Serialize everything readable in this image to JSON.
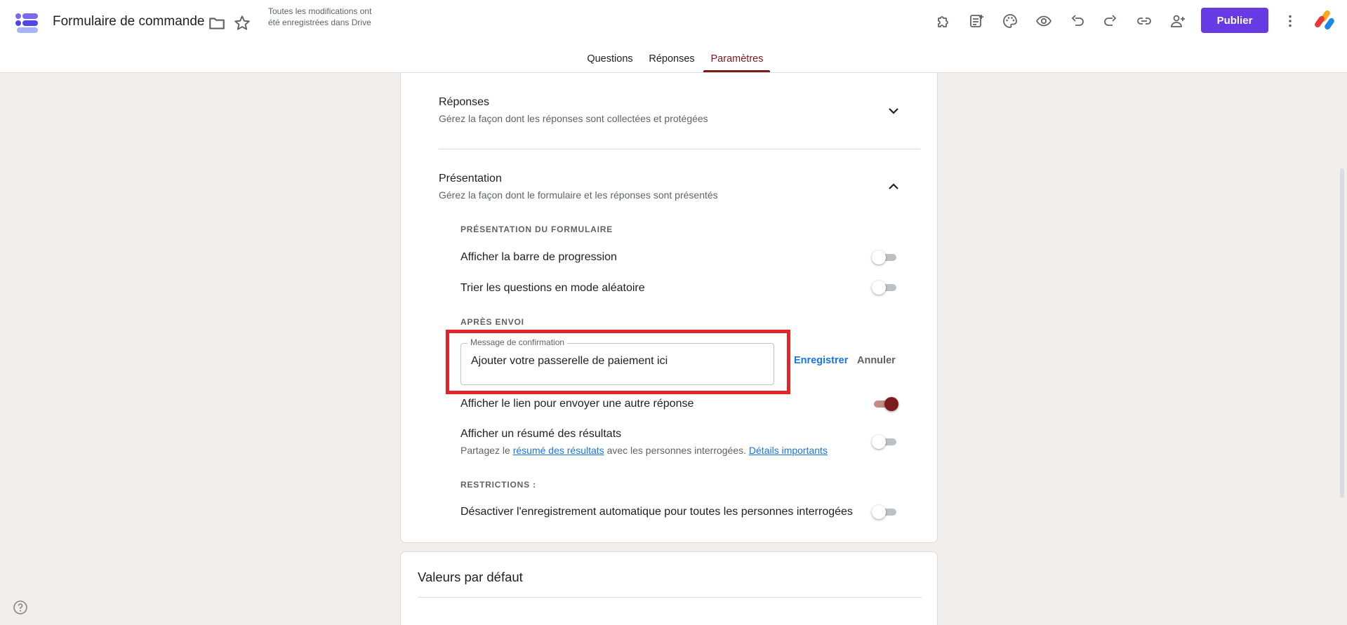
{
  "header": {
    "doc_title": "Formulaire de commande",
    "save_status": "Toutes les modifications ont été enregistrées dans Drive",
    "publish_label": "Publier",
    "icons": [
      "folder-icon",
      "star-icon",
      "puzzle-icon",
      "add-note-icon",
      "palette-icon",
      "eye-icon",
      "undo-icon",
      "redo-icon",
      "link-icon",
      "add-person-icon",
      "more-vert-icon"
    ]
  },
  "tabs": [
    {
      "label": "Questions",
      "active": false
    },
    {
      "label": "Réponses",
      "active": false
    },
    {
      "label": "Paramètres",
      "active": true
    }
  ],
  "sections": {
    "responses": {
      "title": "Réponses",
      "subtitle": "Gérez la façon dont les réponses sont collectées et protégées",
      "expanded": false
    },
    "presentation": {
      "title": "Présentation",
      "subtitle": "Gérez la façon dont le formulaire et les réponses sont présentés",
      "expanded": true,
      "form_presentation_label": "PRÉSENTATION DU FORMULAIRE",
      "progress_bar": {
        "label": "Afficher la barre de progression",
        "on": false
      },
      "shuffle": {
        "label": "Trier les questions en mode aléatoire",
        "on": false
      },
      "after_submit_label": "APRÈS ENVOI",
      "confirmation": {
        "field_label": "Message de confirmation",
        "value": "Ajouter votre passerelle de paiement ici",
        "save_label": "Enregistrer",
        "cancel_label": "Annuler"
      },
      "another_response": {
        "label": "Afficher le lien pour envoyer une autre réponse",
        "on": true
      },
      "results_summary": {
        "label": "Afficher un résumé des résultats",
        "sub_prefix": "Partagez le",
        "sub_link1": "résumé des résultats",
        "sub_middle": "avec les personnes interrogées.",
        "sub_link2": "Détails importants",
        "on": false
      },
      "restrictions_label": "RESTRICTIONS :",
      "autosave": {
        "label": "Désactiver l'enregistrement automatique pour toutes les personnes interrogées",
        "on": false
      }
    }
  },
  "defaults_card": {
    "title": "Valeurs par défaut"
  },
  "colors": {
    "accent": "#7b1b1b",
    "publish": "#673ae4",
    "link": "#1a73e8",
    "highlight": "#e0262b"
  }
}
